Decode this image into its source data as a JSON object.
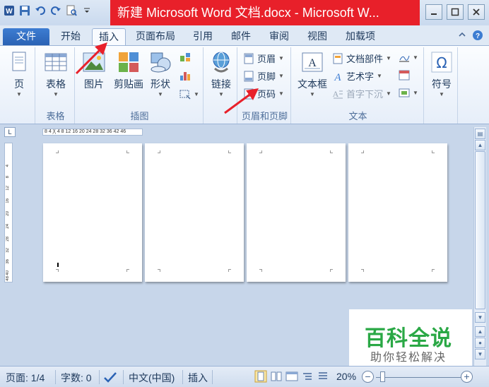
{
  "window": {
    "title": "新建 Microsoft Word 文档.docx - Microsoft W...",
    "title_bg": "#e8202a"
  },
  "qat": {
    "icons": [
      "word-icon",
      "save-icon",
      "undo-icon",
      "redo-icon",
      "print-preview-icon",
      "customize-icon"
    ]
  },
  "tabs": [
    {
      "label": "文件"
    },
    {
      "label": "开始"
    },
    {
      "label": "插入"
    },
    {
      "label": "页面布局"
    },
    {
      "label": "引用"
    },
    {
      "label": "邮件"
    },
    {
      "label": "审阅"
    },
    {
      "label": "视图"
    },
    {
      "label": "加载项"
    }
  ],
  "ribbon": {
    "page": {
      "label": "页"
    },
    "tables": {
      "button": "表格",
      "group": "表格"
    },
    "illustrations": {
      "picture": "图片",
      "clipart": "剪贴画",
      "shapes": "形状",
      "group": "插图"
    },
    "links": {
      "label": "链接"
    },
    "header_footer": {
      "header": "页眉",
      "footer": "页脚",
      "page_number": "页码",
      "group": "页眉和页脚"
    },
    "text": {
      "textbox": "文本框",
      "quickparts": "文档部件",
      "wordart": "艺术字",
      "dropcap": "首字下沉",
      "group": "文本"
    },
    "symbols": {
      "label": "符号"
    }
  },
  "ruler": {
    "corner": "L",
    "horizontal": "8  4  ╳  4  8 12 16 20 24 28 32 36  42 46",
    "vertical": [
      "4",
      "8",
      "12",
      "16",
      "20",
      "24",
      "28",
      "32",
      "36",
      "40",
      "48"
    ]
  },
  "watermark": {
    "logo": "百科全说",
    "sub": "助你轻松解决",
    "color": "#2aa845"
  },
  "status": {
    "page": "页面: 1/4",
    "words": "字数: 0",
    "language": "中文(中国)",
    "mode": "插入",
    "zoom": "20%",
    "zoom_level": 0.2
  }
}
